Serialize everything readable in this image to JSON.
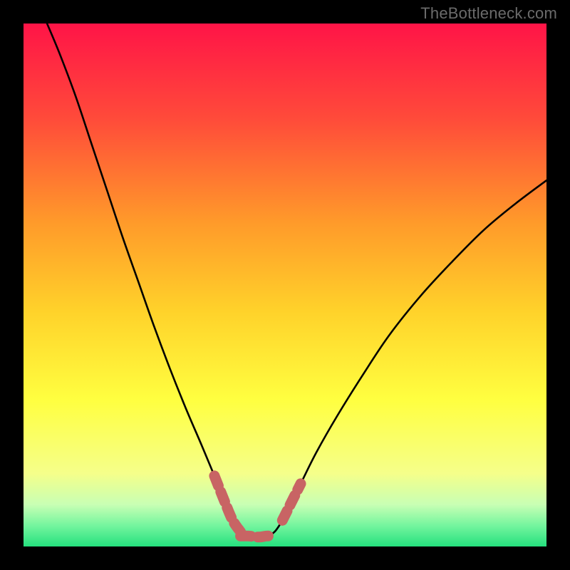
{
  "watermark": {
    "text": "TheBottleneck.com"
  },
  "colors": {
    "background": "#000000",
    "curve": "#000000",
    "highlight": "#c86464",
    "watermark": "#6b6b6b"
  },
  "chart_data": {
    "type": "line",
    "title": "",
    "xlabel": "",
    "ylabel": "",
    "xlim": [
      0,
      100
    ],
    "ylim": [
      0,
      100
    ],
    "note": "Bottleneck curve; minimum near x≈40–48, y≈2. No numeric axis labels visible.",
    "gradient_stops": [
      {
        "offset": 0.0,
        "color": "#ff1447"
      },
      {
        "offset": 0.18,
        "color": "#ff4a3a"
      },
      {
        "offset": 0.38,
        "color": "#ff9a2a"
      },
      {
        "offset": 0.55,
        "color": "#ffd22a"
      },
      {
        "offset": 0.72,
        "color": "#ffff40"
      },
      {
        "offset": 0.86,
        "color": "#f5ff8a"
      },
      {
        "offset": 0.92,
        "color": "#c8ffb4"
      },
      {
        "offset": 0.96,
        "color": "#74f59e"
      },
      {
        "offset": 1.0,
        "color": "#25e07e"
      }
    ],
    "series": [
      {
        "name": "bottleneck-curve",
        "points": [
          {
            "x": 4.5,
            "y": 100.0
          },
          {
            "x": 7.0,
            "y": 94.0
          },
          {
            "x": 10.0,
            "y": 86.0
          },
          {
            "x": 13.0,
            "y": 77.0
          },
          {
            "x": 16.0,
            "y": 68.0
          },
          {
            "x": 19.0,
            "y": 59.0
          },
          {
            "x": 22.0,
            "y": 50.5
          },
          {
            "x": 25.0,
            "y": 42.0
          },
          {
            "x": 28.0,
            "y": 34.0
          },
          {
            "x": 31.0,
            "y": 26.5
          },
          {
            "x": 34.0,
            "y": 19.5
          },
          {
            "x": 36.5,
            "y": 13.5
          },
          {
            "x": 38.5,
            "y": 8.5
          },
          {
            "x": 40.0,
            "y": 5.0
          },
          {
            "x": 41.5,
            "y": 2.8
          },
          {
            "x": 43.0,
            "y": 2.0
          },
          {
            "x": 45.0,
            "y": 1.8
          },
          {
            "x": 46.5,
            "y": 2.0
          },
          {
            "x": 48.0,
            "y": 2.8
          },
          {
            "x": 49.5,
            "y": 5.0
          },
          {
            "x": 51.0,
            "y": 8.0
          },
          {
            "x": 53.0,
            "y": 12.0
          },
          {
            "x": 56.0,
            "y": 18.0
          },
          {
            "x": 60.0,
            "y": 25.0
          },
          {
            "x": 65.0,
            "y": 33.0
          },
          {
            "x": 70.0,
            "y": 40.5
          },
          {
            "x": 76.0,
            "y": 48.0
          },
          {
            "x": 82.0,
            "y": 54.5
          },
          {
            "x": 88.0,
            "y": 60.5
          },
          {
            "x": 94.0,
            "y": 65.5
          },
          {
            "x": 100.0,
            "y": 70.0
          }
        ]
      }
    ],
    "highlight_segments": [
      {
        "name": "left-descent-marker",
        "points": [
          {
            "x": 36.5,
            "y": 13.5
          },
          {
            "x": 38.5,
            "y": 8.5
          },
          {
            "x": 40.0,
            "y": 5.0
          },
          {
            "x": 41.5,
            "y": 2.8
          }
        ]
      },
      {
        "name": "trough-marker",
        "points": [
          {
            "x": 41.5,
            "y": 2.0
          },
          {
            "x": 43.0,
            "y": 2.0
          },
          {
            "x": 45.0,
            "y": 1.8
          },
          {
            "x": 46.5,
            "y": 2.0
          },
          {
            "x": 48.0,
            "y": 2.0
          }
        ]
      },
      {
        "name": "right-ascent-marker",
        "points": [
          {
            "x": 49.5,
            "y": 5.0
          },
          {
            "x": 51.0,
            "y": 8.0
          },
          {
            "x": 53.0,
            "y": 12.0
          }
        ]
      }
    ]
  }
}
